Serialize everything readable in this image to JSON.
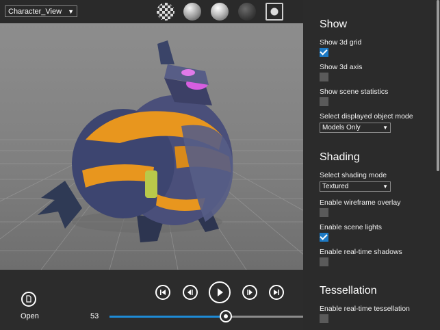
{
  "viewport": {
    "view_selector": "Character_View",
    "material_balls": [
      "checker-ball-icon",
      "matte-sphere-icon",
      "light-bulb-icon",
      "dark-sphere-icon",
      "frame-selection-icon"
    ]
  },
  "playback": {
    "open_label": "Open",
    "frame": "53",
    "progress": 0.6,
    "buttons": [
      "skip-to-start-icon",
      "step-back-icon",
      "play-icon",
      "step-forward-icon",
      "skip-to-end-icon"
    ]
  },
  "panel": {
    "show": {
      "title": "Show",
      "grid_label": "Show 3d grid",
      "grid_checked": true,
      "axis_label": "Show 3d axis",
      "axis_checked": false,
      "stats_label": "Show scene statistics",
      "stats_checked": false,
      "mode_label": "Select displayed object mode",
      "mode_value": "Models Only"
    },
    "shading": {
      "title": "Shading",
      "mode_label": "Select shading mode",
      "mode_value": "Textured",
      "wireframe_label": "Enable wireframe overlay",
      "wireframe_checked": false,
      "lights_label": "Enable scene lights",
      "lights_checked": true,
      "shadows_label": "Enable real-time shadows",
      "shadows_checked": false
    },
    "tessellation": {
      "title": "Tessellation",
      "tess_label": "Enable real-time tessellation",
      "tess_checked": false
    }
  },
  "colors": {
    "accent": "#1c79c4",
    "slider_fill": "#1e8bd6",
    "armor_orange": "#e8961e",
    "armor_blue": "#4a4f7a"
  }
}
